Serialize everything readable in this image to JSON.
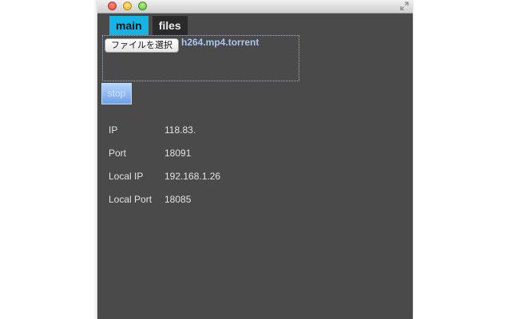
{
  "tabs": [
    {
      "label": "main",
      "active": true
    },
    {
      "label": "files",
      "active": false
    }
  ],
  "upload": {
    "button_label": "ファイルを選択",
    "file_name": "h264.mp4.torrent"
  },
  "stop_label": "stop",
  "info": [
    {
      "label": "IP",
      "value": "118.83."
    },
    {
      "label": "Port",
      "value": "18091"
    },
    {
      "label": "Local IP",
      "value": "192.168.1.26"
    },
    {
      "label": "Local Port",
      "value": "18085"
    }
  ],
  "colors": {
    "window_bg": "#4a4a4a",
    "tab_active": "#14b4e6",
    "tab_inactive": "#2a2a2a",
    "file_name": "#a9c6f2",
    "stop_button": "#8fb8f0"
  },
  "icons": [
    "close-light",
    "minimize-light",
    "zoom-light",
    "fullscreen-resize-icon"
  ]
}
